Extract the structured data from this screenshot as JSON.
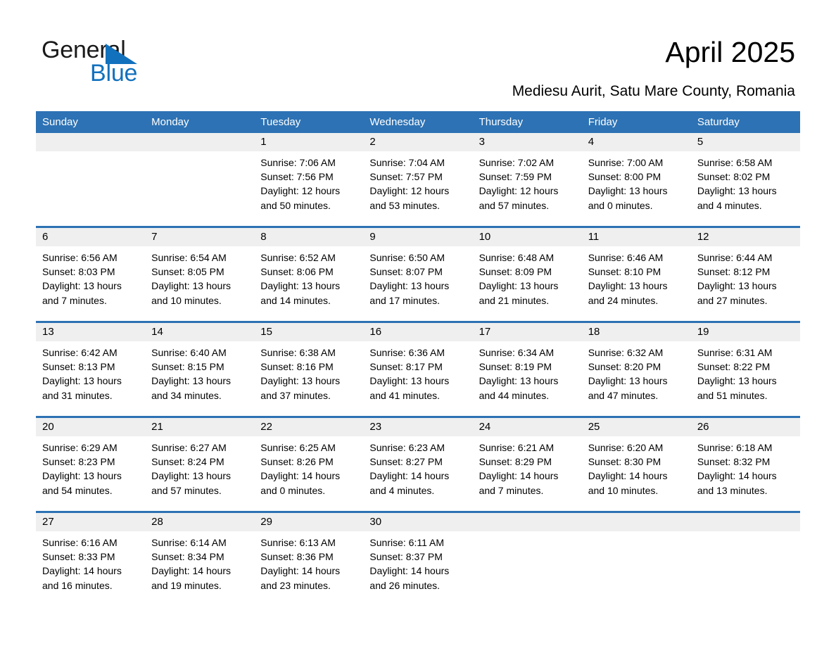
{
  "logo": {
    "word1": "General",
    "word2": "Blue",
    "triangle_color": "#1271bd"
  },
  "header": {
    "title": "April 2025",
    "subtitle": "Mediesu Aurit, Satu Mare County, Romania"
  },
  "theme": {
    "accent": "#2d72b4",
    "daynum_background": "#efefef",
    "header_text": "#ffffff",
    "page_background": "#ffffff"
  },
  "calendar": {
    "weekday_headers": [
      "Sunday",
      "Monday",
      "Tuesday",
      "Wednesday",
      "Thursday",
      "Friday",
      "Saturday"
    ],
    "weeks": [
      [
        {
          "day": "",
          "blank": true,
          "lines": []
        },
        {
          "day": "",
          "blank": true,
          "lines": []
        },
        {
          "day": "1",
          "lines": [
            "Sunrise: 7:06 AM",
            "Sunset: 7:56 PM",
            "Daylight: 12 hours",
            "and 50 minutes."
          ]
        },
        {
          "day": "2",
          "lines": [
            "Sunrise: 7:04 AM",
            "Sunset: 7:57 PM",
            "Daylight: 12 hours",
            "and 53 minutes."
          ]
        },
        {
          "day": "3",
          "lines": [
            "Sunrise: 7:02 AM",
            "Sunset: 7:59 PM",
            "Daylight: 12 hours",
            "and 57 minutes."
          ]
        },
        {
          "day": "4",
          "lines": [
            "Sunrise: 7:00 AM",
            "Sunset: 8:00 PM",
            "Daylight: 13 hours",
            "and 0 minutes."
          ]
        },
        {
          "day": "5",
          "lines": [
            "Sunrise: 6:58 AM",
            "Sunset: 8:02 PM",
            "Daylight: 13 hours",
            "and 4 minutes."
          ]
        }
      ],
      [
        {
          "day": "6",
          "lines": [
            "Sunrise: 6:56 AM",
            "Sunset: 8:03 PM",
            "Daylight: 13 hours",
            "and 7 minutes."
          ]
        },
        {
          "day": "7",
          "lines": [
            "Sunrise: 6:54 AM",
            "Sunset: 8:05 PM",
            "Daylight: 13 hours",
            "and 10 minutes."
          ]
        },
        {
          "day": "8",
          "lines": [
            "Sunrise: 6:52 AM",
            "Sunset: 8:06 PM",
            "Daylight: 13 hours",
            "and 14 minutes."
          ]
        },
        {
          "day": "9",
          "lines": [
            "Sunrise: 6:50 AM",
            "Sunset: 8:07 PM",
            "Daylight: 13 hours",
            "and 17 minutes."
          ]
        },
        {
          "day": "10",
          "lines": [
            "Sunrise: 6:48 AM",
            "Sunset: 8:09 PM",
            "Daylight: 13 hours",
            "and 21 minutes."
          ]
        },
        {
          "day": "11",
          "lines": [
            "Sunrise: 6:46 AM",
            "Sunset: 8:10 PM",
            "Daylight: 13 hours",
            "and 24 minutes."
          ]
        },
        {
          "day": "12",
          "lines": [
            "Sunrise: 6:44 AM",
            "Sunset: 8:12 PM",
            "Daylight: 13 hours",
            "and 27 minutes."
          ]
        }
      ],
      [
        {
          "day": "13",
          "lines": [
            "Sunrise: 6:42 AM",
            "Sunset: 8:13 PM",
            "Daylight: 13 hours",
            "and 31 minutes."
          ]
        },
        {
          "day": "14",
          "lines": [
            "Sunrise: 6:40 AM",
            "Sunset: 8:15 PM",
            "Daylight: 13 hours",
            "and 34 minutes."
          ]
        },
        {
          "day": "15",
          "lines": [
            "Sunrise: 6:38 AM",
            "Sunset: 8:16 PM",
            "Daylight: 13 hours",
            "and 37 minutes."
          ]
        },
        {
          "day": "16",
          "lines": [
            "Sunrise: 6:36 AM",
            "Sunset: 8:17 PM",
            "Daylight: 13 hours",
            "and 41 minutes."
          ]
        },
        {
          "day": "17",
          "lines": [
            "Sunrise: 6:34 AM",
            "Sunset: 8:19 PM",
            "Daylight: 13 hours",
            "and 44 minutes."
          ]
        },
        {
          "day": "18",
          "lines": [
            "Sunrise: 6:32 AM",
            "Sunset: 8:20 PM",
            "Daylight: 13 hours",
            "and 47 minutes."
          ]
        },
        {
          "day": "19",
          "lines": [
            "Sunrise: 6:31 AM",
            "Sunset: 8:22 PM",
            "Daylight: 13 hours",
            "and 51 minutes."
          ]
        }
      ],
      [
        {
          "day": "20",
          "lines": [
            "Sunrise: 6:29 AM",
            "Sunset: 8:23 PM",
            "Daylight: 13 hours",
            "and 54 minutes."
          ]
        },
        {
          "day": "21",
          "lines": [
            "Sunrise: 6:27 AM",
            "Sunset: 8:24 PM",
            "Daylight: 13 hours",
            "and 57 minutes."
          ]
        },
        {
          "day": "22",
          "lines": [
            "Sunrise: 6:25 AM",
            "Sunset: 8:26 PM",
            "Daylight: 14 hours",
            "and 0 minutes."
          ]
        },
        {
          "day": "23",
          "lines": [
            "Sunrise: 6:23 AM",
            "Sunset: 8:27 PM",
            "Daylight: 14 hours",
            "and 4 minutes."
          ]
        },
        {
          "day": "24",
          "lines": [
            "Sunrise: 6:21 AM",
            "Sunset: 8:29 PM",
            "Daylight: 14 hours",
            "and 7 minutes."
          ]
        },
        {
          "day": "25",
          "lines": [
            "Sunrise: 6:20 AM",
            "Sunset: 8:30 PM",
            "Daylight: 14 hours",
            "and 10 minutes."
          ]
        },
        {
          "day": "26",
          "lines": [
            "Sunrise: 6:18 AM",
            "Sunset: 8:32 PM",
            "Daylight: 14 hours",
            "and 13 minutes."
          ]
        }
      ],
      [
        {
          "day": "27",
          "lines": [
            "Sunrise: 6:16 AM",
            "Sunset: 8:33 PM",
            "Daylight: 14 hours",
            "and 16 minutes."
          ]
        },
        {
          "day": "28",
          "lines": [
            "Sunrise: 6:14 AM",
            "Sunset: 8:34 PM",
            "Daylight: 14 hours",
            "and 19 minutes."
          ]
        },
        {
          "day": "29",
          "lines": [
            "Sunrise: 6:13 AM",
            "Sunset: 8:36 PM",
            "Daylight: 14 hours",
            "and 23 minutes."
          ]
        },
        {
          "day": "30",
          "lines": [
            "Sunrise: 6:11 AM",
            "Sunset: 8:37 PM",
            "Daylight: 14 hours",
            "and 26 minutes."
          ]
        },
        {
          "day": "",
          "blank": true,
          "lines": []
        },
        {
          "day": "",
          "blank": true,
          "lines": []
        },
        {
          "day": "",
          "blank": true,
          "lines": []
        }
      ]
    ]
  }
}
